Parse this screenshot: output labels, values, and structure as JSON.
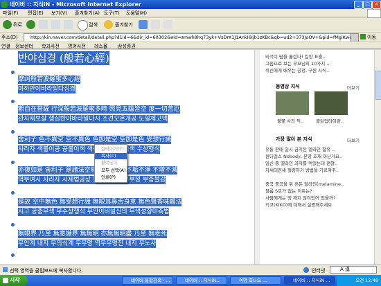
{
  "window": {
    "title": "네이버 :: 지식iN - Microsoft Internet Explorer",
    "min": "_",
    "max": "□",
    "close": "×"
  },
  "menu": [
    "파일(F)",
    "편집(E)",
    "보기(V)",
    "즐겨찾기(A)",
    "도구(T)",
    "도움말(H)"
  ],
  "toolbar": {
    "back": "뒤로",
    "search": "검색",
    "favorites": "즐겨찾기"
  },
  "address": {
    "label": "주소(D)",
    "url": "http://kin.naver.com/detail/detail.php?d1id=6&dir_id=60302&eid=smwh9hq73yk+VsDrK1J1AnkI6Ijb1zKBc&qb=ud2+373JoOV+&pid=fMgiKwoi5Tosst2Is0sss=",
    "go": "이동"
  },
  "links": {
    "label": "연결",
    "items": [
      "정보센터",
      "학과사전",
      "영어사전",
      "레스몰",
      "삼성증권"
    ]
  },
  "main": {
    "title": "반야심경 (般若心經)",
    "lines": [
      "摩訶般若波羅蜜多心經",
      "마하반야바라밀다심경",
      "觀自在菩薩 行深般若波羅蜜多時 照見五蘊皆空 度一切苦厄",
      "관자재보살 행심반야바라밀다시 조견오온개공 도일체고액",
      "舍利子 色不異空 空不異色 色卽是空 空卽是色 受想行識",
      "사리자 색불이공 공불이색 색즉시공 공즉시색 수상행식",
      "亦復如是 舍利子 是諸法空相 不生不滅 不垢不淨 不增不減",
      "역부여시 사리자 시제법공상 불생불멸 불구부정 부증불감",
      "是故 空中無色 無受想行識 無眼耳鼻舌身意 無色聲香味觸法",
      "시고 공중무색 무수상행식 무안이비설신의 무색성향미촉법",
      "無眼界 乃至 無意識界 無無明 亦無無明盡 乃至 無老死",
      "무안계 내지 무의식계 무무명 역무무명진 내지 무노사"
    ]
  },
  "context_menu": {
    "items": [
      {
        "label": "잘라내기(T)",
        "enabled": false
      },
      {
        "label": "복사(C)",
        "enabled": true
      },
      {
        "label": "붙여넣기",
        "enabled": false
      },
      {
        "label": "모두 선택(A)",
        "enabled": true
      },
      {
        "label": "인쇄(P)",
        "enabled": true
      }
    ]
  },
  "sidebar": {
    "top_items": [
      "비석이 땀을 흘린다! 일양 표충..",
      "그림으로 보는 부모님의 10가지 ..",
      "쉬신에게 배우는 공정, 구원 시식.."
    ],
    "video_section": {
      "title": "동영상 지식",
      "more": "더보기",
      "captions": [
        "불꽃 사진 찍..",
        "클린업타이완.."
      ]
    },
    "popular_section": {
      "title": "가장 많이 본 지식",
      "more": "더보기",
      "items": [
        "유통 판매 일시 금지된 멜라민 함유 ..",
        "원더걸스 Nobody, 본명 호재 아닌가요..",
        "임신 중 멜라민 과자를 먹었는데 괜찮..",
        "차세대전세 질량하기 방법을 가르쳐주..",
        "중국 중국을 위 흔든 멜라민(melamine..",
        "블룸 S효가 없는 이유는?",
        "사람에게는 멍 깨지 많이있어 있을까?",
        "키코(KIKO)에 대해서 설명해주세요"
      ]
    }
  },
  "statusbar": {
    "text": "선택 영역을 클립보드에 복사합니다.",
    "zone": "인터넷"
  },
  "taskbar": {
    "start": "시작",
    "tasks": [
      "네이버 통합검색 - ...",
      "네이버 :: 지식iN...",
      "여명 회나요 ...",
      "네이버 :: 지식iN ..."
    ],
    "time": "오전 12:48",
    "ime": "A 漢"
  },
  "colors": {
    "selection": "#316ac5",
    "titlebar": "#0a3fb2",
    "taskbar": "#245edb",
    "start": "#2e8b1e"
  }
}
